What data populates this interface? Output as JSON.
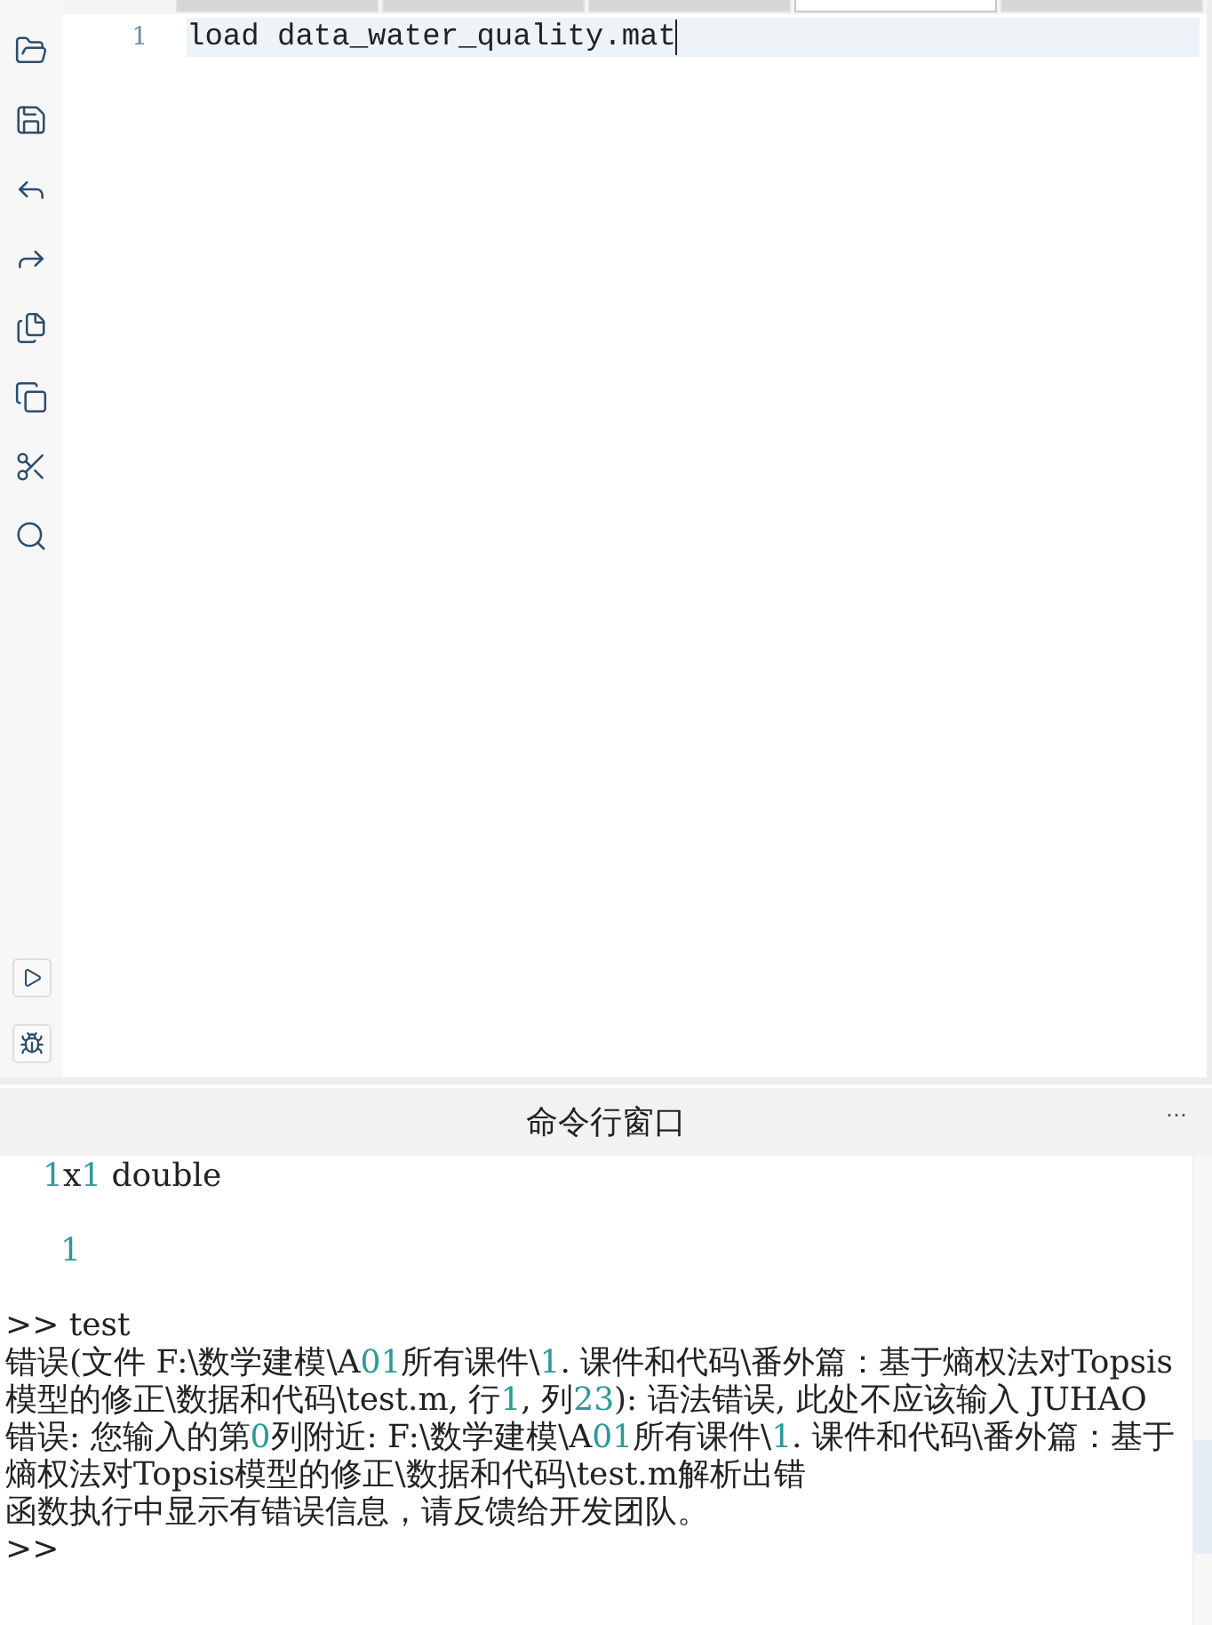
{
  "editor": {
    "tabs": [
      {
        "selected": false
      },
      {
        "selected": false
      },
      {
        "selected": false
      },
      {
        "selected": true
      },
      {
        "selected": false
      }
    ],
    "lines": [
      {
        "number": "1",
        "code": "load data_water_quality.mat",
        "current": true
      }
    ]
  },
  "command_window": {
    "title": "命令行窗口",
    "menu": "⋯",
    "lines": [
      {
        "kind": "output",
        "text": "1x1 double"
      },
      {
        "kind": "blank"
      },
      {
        "kind": "value",
        "text": "1"
      },
      {
        "kind": "blank"
      },
      {
        "kind": "prompt",
        "prompt": ">>",
        "text": "test"
      },
      {
        "kind": "error",
        "text": "错误(文件 F:\\数学建模\\A01所有课件\\1. 课件和代码\\番外篇：基于熵权法对Topsis模型的修正\\数据和代码\\test.m, 行1, 列23): 语法错误, 此处不应该输入 JUHAO"
      },
      {
        "kind": "error",
        "text": "错误: 您输入的第0列附近: F:\\数学建模\\A01所有课件\\1. 课件和代码\\番外篇：基于熵权法对Topsis模型的修正\\数据和代码\\test.m解析出错"
      },
      {
        "kind": "error",
        "text": "函数执行中显示有错误信息，请反馈给开发团队。"
      },
      {
        "kind": "prompt",
        "prompt": ">>"
      }
    ]
  }
}
